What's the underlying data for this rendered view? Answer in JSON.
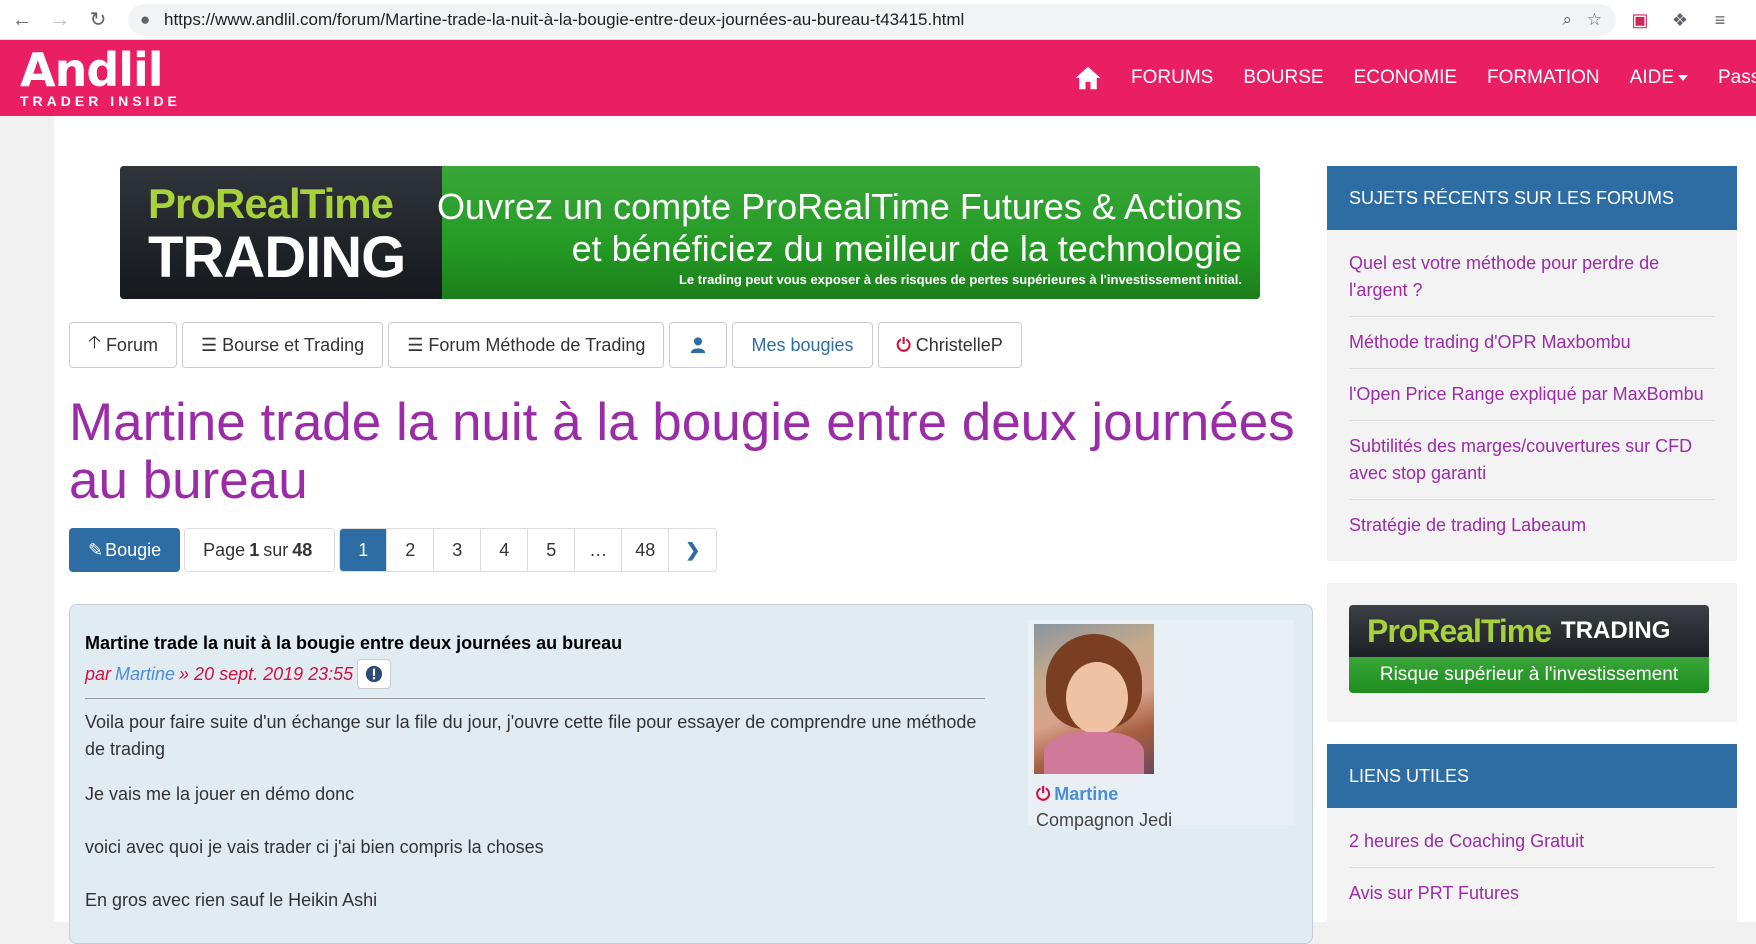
{
  "browser": {
    "url": "https://www.andlil.com/forum/Martine-trade-la-nuit-à-la-bougie-entre-deux-journées-au-bureau-t43415.html"
  },
  "header": {
    "logo_main": "Andlil",
    "logo_sub": "TRADER INSIDE",
    "nav": [
      "FORUMS",
      "BOURSE",
      "ECONOMIE",
      "FORMATION",
      "AIDE",
      "Passion"
    ],
    "brand_color": "#ea1f63"
  },
  "banner": {
    "brand_top": "ProRealTime",
    "brand_bottom": "TRADING",
    "line1": "Ouvrez un compte ProRealTime Futures & Actions",
    "line2": "et bénéficiez du meilleur de la technologie",
    "line3": "Le trading peut vous exposer à des risques de pertes supérieures à l'investissement initial."
  },
  "toolbar": {
    "forum": "Forum",
    "bourse": "Bourse et Trading",
    "methode": "Forum Méthode de Trading",
    "bougies": "Mes bougies",
    "user": "ChristelleP"
  },
  "topic": {
    "title": "Martine trade la nuit à la bougie entre deux journées au bureau"
  },
  "pagination": {
    "new_label": "Bougie",
    "page_prefix": "Page",
    "current": "1",
    "of": "sur",
    "total": "48",
    "pages": [
      "1",
      "2",
      "3",
      "4",
      "5",
      "…",
      "48"
    ]
  },
  "post": {
    "title": "Martine trade la nuit à la bougie entre deux journées au bureau",
    "by": "par",
    "author": "Martine",
    "date": "» 20 sept. 2019 23:55",
    "paragraphs": [
      "Voila pour faire suite d'un échange sur la file du jour, j'ouvre cette file pour essayer de comprendre une méthode de trading",
      "Je vais me la jouer en démo donc",
      "voici avec quoi je vais trader ci j'ai bien compris la choses",
      "En gros avec rien sauf le Heikin Ashi"
    ],
    "profile_name": "Martine",
    "profile_rank": "Compagnon Jedi"
  },
  "sidebar": {
    "recent_title": "SUJETS RÉCENTS SUR LES FORUMS",
    "recent": [
      "Quel est votre méthode pour perdre de l'argent ?",
      "Méthode trading d'OPR Maxbombu",
      "l'Open Price Range expliqué par MaxBombu",
      "Subtilités des marges/couvertures sur CFD avec stop garanti",
      "Stratégie de trading Labeaum"
    ],
    "ad_pro": "ProRealTime",
    "ad_trading": "TRADING",
    "ad_risk": "Risque supérieur à l'investissement",
    "links_title": "LIENS UTILES",
    "links": [
      "2 heures de Coaching Gratuit",
      "Avis sur PRT Futures"
    ]
  }
}
